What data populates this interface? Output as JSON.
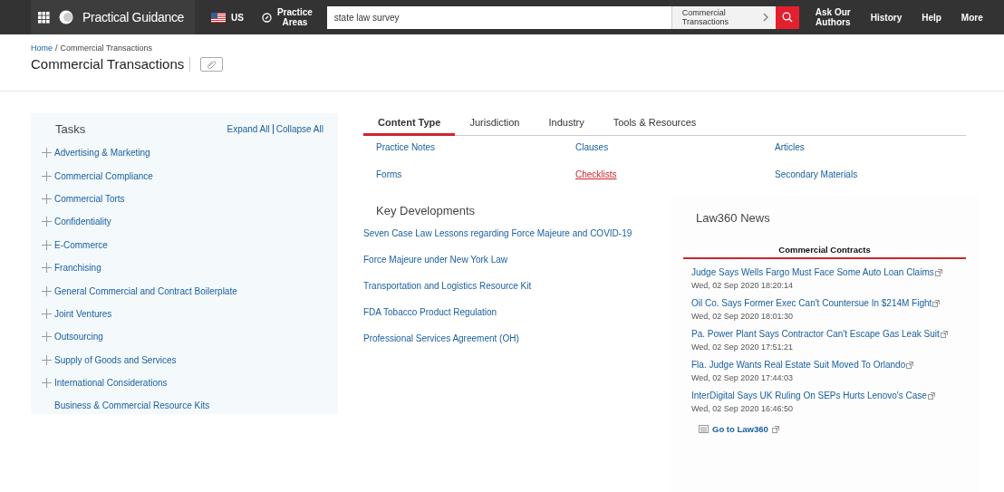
{
  "header": {
    "brand": "Practical Guidance",
    "region": "US",
    "practice_areas": "Practice\nAreas",
    "search": {
      "value": "state law survey"
    },
    "scope": "Commercial\nTransactions",
    "nav": [
      "Ask Our\nAuthors",
      "History",
      "Help",
      "More"
    ]
  },
  "breadcrumb": [
    "Home",
    "Commercial Transactions"
  ],
  "breadcrumb_separator": "/",
  "page_title": "Commercial Transactions",
  "tasks": {
    "title": "Tasks",
    "expand_all": "Expand All",
    "collapse_all": "Collapse All",
    "items": [
      {
        "label": "Advertising & Marketing",
        "kind": "group"
      },
      {
        "label": "Commercial Compliance",
        "kind": "group"
      },
      {
        "label": "Commercial Torts",
        "kind": "group"
      },
      {
        "label": "Confidentiality",
        "kind": "group"
      },
      {
        "label": "E-Commerce",
        "kind": "group"
      },
      {
        "label": "Franchising",
        "kind": "group"
      },
      {
        "label": "General Commercial and Contract Boilerplate",
        "kind": "group"
      },
      {
        "label": "Joint Ventures",
        "kind": "group"
      },
      {
        "label": "Outsourcing",
        "kind": "group"
      },
      {
        "label": "Supply of Goods and Services",
        "kind": "group"
      },
      {
        "label": "International Considerations",
        "kind": "group"
      },
      {
        "label": "Business & Commercial Resource Kits",
        "kind": "link"
      }
    ]
  },
  "tabs": [
    {
      "label": "Content Type",
      "selected": true
    },
    {
      "label": "Jurisdiction",
      "selected": false
    },
    {
      "label": "Industry",
      "selected": false
    },
    {
      "label": "Tools & Resources",
      "selected": false
    }
  ],
  "content_types": [
    {
      "label": "Practice Notes",
      "highlighted": false
    },
    {
      "label": "Clauses",
      "highlighted": false
    },
    {
      "label": "Articles",
      "highlighted": false
    },
    {
      "label": "Forms",
      "highlighted": false
    },
    {
      "label": "Checklists",
      "highlighted": true
    },
    {
      "label": "Secondary Materials",
      "highlighted": false
    }
  ],
  "key_developments": {
    "title": "Key Developments",
    "items": [
      "Seven Case Law Lessons regarding Force Majeure and COVID-19",
      "Force Majeure under New York Law",
      "Transportation and Logistics Resource Kit",
      "FDA Tobacco Product Regulation",
      "Professional Services Agreement (OH)"
    ]
  },
  "news": {
    "title": "Law360 News",
    "tab": "Commercial Contracts",
    "items": [
      {
        "headline": "Judge Says Wells Fargo Must Face Some Auto Loan Claims",
        "date": "Wed, 02 Sep 2020 18:20:14"
      },
      {
        "headline": "Oil Co. Says Former Exec Can't Countersue In $214M Fight",
        "date": "Wed, 02 Sep 2020 18:01:30"
      },
      {
        "headline": "Pa. Power Plant Says Contractor Can't Escape Gas Leak Suit",
        "date": "Wed, 02 Sep 2020 17:51:21"
      },
      {
        "headline": "Fla. Judge Wants Real Estate Suit Moved To Orlando",
        "date": "Wed, 02 Sep 2020 17:44:03"
      },
      {
        "headline": "InterDigital Says UK Ruling On SEPs Hurts Lenovo's Case",
        "date": "Wed, 02 Sep 2020 16:46:50"
      }
    ],
    "footer_link": "Go to Law360"
  }
}
